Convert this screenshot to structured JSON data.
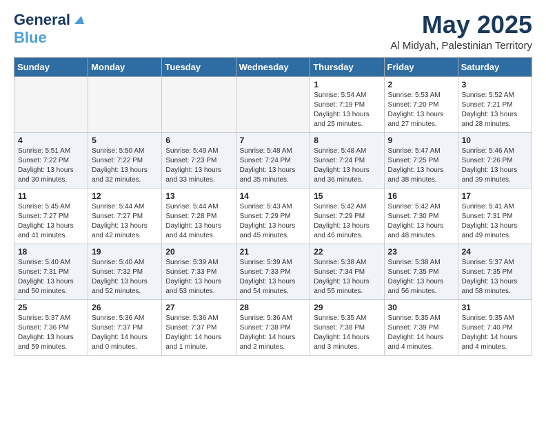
{
  "logo": {
    "line1": "General",
    "line2": "Blue"
  },
  "title": "May 2025",
  "subtitle": "Al Midyah, Palestinian Territory",
  "weekdays": [
    "Sunday",
    "Monday",
    "Tuesday",
    "Wednesday",
    "Thursday",
    "Friday",
    "Saturday"
  ],
  "weeks": [
    [
      {
        "day": "",
        "info": ""
      },
      {
        "day": "",
        "info": ""
      },
      {
        "day": "",
        "info": ""
      },
      {
        "day": "",
        "info": ""
      },
      {
        "day": "1",
        "info": "Sunrise: 5:54 AM\nSunset: 7:19 PM\nDaylight: 13 hours\nand 25 minutes."
      },
      {
        "day": "2",
        "info": "Sunrise: 5:53 AM\nSunset: 7:20 PM\nDaylight: 13 hours\nand 27 minutes."
      },
      {
        "day": "3",
        "info": "Sunrise: 5:52 AM\nSunset: 7:21 PM\nDaylight: 13 hours\nand 28 minutes."
      }
    ],
    [
      {
        "day": "4",
        "info": "Sunrise: 5:51 AM\nSunset: 7:22 PM\nDaylight: 13 hours\nand 30 minutes."
      },
      {
        "day": "5",
        "info": "Sunrise: 5:50 AM\nSunset: 7:22 PM\nDaylight: 13 hours\nand 32 minutes."
      },
      {
        "day": "6",
        "info": "Sunrise: 5:49 AM\nSunset: 7:23 PM\nDaylight: 13 hours\nand 33 minutes."
      },
      {
        "day": "7",
        "info": "Sunrise: 5:48 AM\nSunset: 7:24 PM\nDaylight: 13 hours\nand 35 minutes."
      },
      {
        "day": "8",
        "info": "Sunrise: 5:48 AM\nSunset: 7:24 PM\nDaylight: 13 hours\nand 36 minutes."
      },
      {
        "day": "9",
        "info": "Sunrise: 5:47 AM\nSunset: 7:25 PM\nDaylight: 13 hours\nand 38 minutes."
      },
      {
        "day": "10",
        "info": "Sunrise: 5:46 AM\nSunset: 7:26 PM\nDaylight: 13 hours\nand 39 minutes."
      }
    ],
    [
      {
        "day": "11",
        "info": "Sunrise: 5:45 AM\nSunset: 7:27 PM\nDaylight: 13 hours\nand 41 minutes."
      },
      {
        "day": "12",
        "info": "Sunrise: 5:44 AM\nSunset: 7:27 PM\nDaylight: 13 hours\nand 42 minutes."
      },
      {
        "day": "13",
        "info": "Sunrise: 5:44 AM\nSunset: 7:28 PM\nDaylight: 13 hours\nand 44 minutes."
      },
      {
        "day": "14",
        "info": "Sunrise: 5:43 AM\nSunset: 7:29 PM\nDaylight: 13 hours\nand 45 minutes."
      },
      {
        "day": "15",
        "info": "Sunrise: 5:42 AM\nSunset: 7:29 PM\nDaylight: 13 hours\nand 46 minutes."
      },
      {
        "day": "16",
        "info": "Sunrise: 5:42 AM\nSunset: 7:30 PM\nDaylight: 13 hours\nand 48 minutes."
      },
      {
        "day": "17",
        "info": "Sunrise: 5:41 AM\nSunset: 7:31 PM\nDaylight: 13 hours\nand 49 minutes."
      }
    ],
    [
      {
        "day": "18",
        "info": "Sunrise: 5:40 AM\nSunset: 7:31 PM\nDaylight: 13 hours\nand 50 minutes."
      },
      {
        "day": "19",
        "info": "Sunrise: 5:40 AM\nSunset: 7:32 PM\nDaylight: 13 hours\nand 52 minutes."
      },
      {
        "day": "20",
        "info": "Sunrise: 5:39 AM\nSunset: 7:33 PM\nDaylight: 13 hours\nand 53 minutes."
      },
      {
        "day": "21",
        "info": "Sunrise: 5:39 AM\nSunset: 7:33 PM\nDaylight: 13 hours\nand 54 minutes."
      },
      {
        "day": "22",
        "info": "Sunrise: 5:38 AM\nSunset: 7:34 PM\nDaylight: 13 hours\nand 55 minutes."
      },
      {
        "day": "23",
        "info": "Sunrise: 5:38 AM\nSunset: 7:35 PM\nDaylight: 13 hours\nand 56 minutes."
      },
      {
        "day": "24",
        "info": "Sunrise: 5:37 AM\nSunset: 7:35 PM\nDaylight: 13 hours\nand 58 minutes."
      }
    ],
    [
      {
        "day": "25",
        "info": "Sunrise: 5:37 AM\nSunset: 7:36 PM\nDaylight: 13 hours\nand 59 minutes."
      },
      {
        "day": "26",
        "info": "Sunrise: 5:36 AM\nSunset: 7:37 PM\nDaylight: 14 hours\nand 0 minutes."
      },
      {
        "day": "27",
        "info": "Sunrise: 5:36 AM\nSunset: 7:37 PM\nDaylight: 14 hours\nand 1 minute."
      },
      {
        "day": "28",
        "info": "Sunrise: 5:36 AM\nSunset: 7:38 PM\nDaylight: 14 hours\nand 2 minutes."
      },
      {
        "day": "29",
        "info": "Sunrise: 5:35 AM\nSunset: 7:38 PM\nDaylight: 14 hours\nand 3 minutes."
      },
      {
        "day": "30",
        "info": "Sunrise: 5:35 AM\nSunset: 7:39 PM\nDaylight: 14 hours\nand 4 minutes."
      },
      {
        "day": "31",
        "info": "Sunrise: 5:35 AM\nSunset: 7:40 PM\nDaylight: 14 hours\nand 4 minutes."
      }
    ]
  ]
}
